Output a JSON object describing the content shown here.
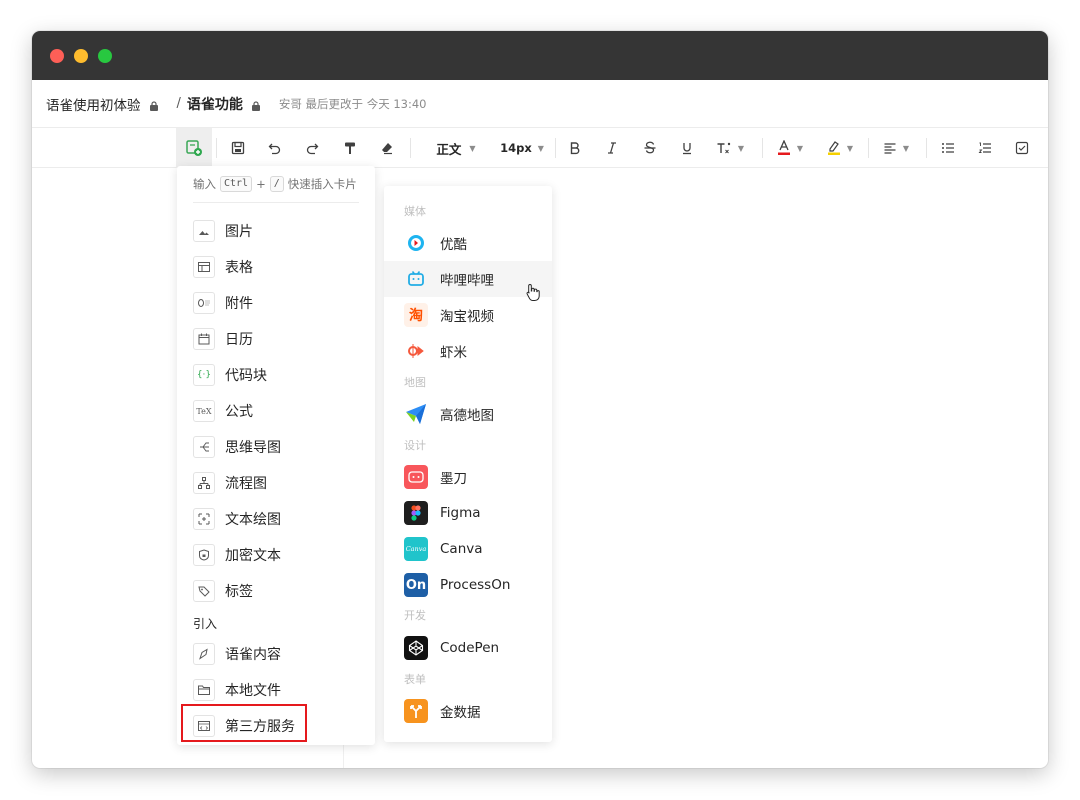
{
  "header": {
    "parent_doc": "语雀使用初体验",
    "separator": "/",
    "doc_title": "语雀功能",
    "meta": "安哥 最后更改于 今天 13:40"
  },
  "toolbar": {
    "style_label": "正文",
    "size_label": "14px"
  },
  "insert_menu": {
    "hint_prefix": "输入",
    "hint_key1": "Ctrl",
    "hint_plus": "+",
    "hint_key2": "/",
    "hint_suffix": "快速插入卡片",
    "items": [
      {
        "label": "图片",
        "icon": "image-icon"
      },
      {
        "label": "表格",
        "icon": "table-icon"
      },
      {
        "label": "附件",
        "icon": "attachment-icon"
      },
      {
        "label": "日历",
        "icon": "calendar-icon"
      },
      {
        "label": "代码块",
        "icon": "code-block-icon"
      },
      {
        "label": "公式",
        "icon": "formula-icon"
      },
      {
        "label": "思维导图",
        "icon": "mindmap-icon"
      },
      {
        "label": "流程图",
        "icon": "flowchart-icon"
      },
      {
        "label": "文本绘图",
        "icon": "text-drawing-icon"
      },
      {
        "label": "加密文本",
        "icon": "encrypted-text-icon"
      },
      {
        "label": "标签",
        "icon": "tag-icon"
      }
    ],
    "import_section": "引入",
    "import_items": [
      {
        "label": "语雀内容",
        "icon": "yuque-content-icon"
      },
      {
        "label": "本地文件",
        "icon": "folder-icon"
      },
      {
        "label": "第三方服务",
        "icon": "third-party-icon"
      }
    ]
  },
  "service_menu": {
    "categories": {
      "media": "媒体",
      "map": "地图",
      "design": "设计",
      "dev": "开发",
      "form": "表单"
    },
    "services": {
      "youku": "优酷",
      "bilibili": "哔哩哔哩",
      "taobao": "淘宝视频",
      "xiami": "虾米",
      "amap": "高德地图",
      "modao": "墨刀",
      "figma": "Figma",
      "canva": "Canva",
      "processon": "ProcessOn",
      "codepen": "CodePen",
      "jinshuju": "金数据"
    },
    "icon_text": {
      "taobao": "淘",
      "canva": "Canva",
      "processon": "On"
    },
    "colors": {
      "youku": "#1eb4f0",
      "bilibili": "#23ade5",
      "taobao": "#ff5000",
      "xiami": "#f5593d",
      "modao": "#f8565b",
      "figma": "#1e1e1e",
      "canva": "#20c4cb",
      "processon": "#1e5fa6",
      "codepen": "#111111",
      "jinshuju": "#f7931e"
    }
  },
  "highlight_color": "#e5191d"
}
